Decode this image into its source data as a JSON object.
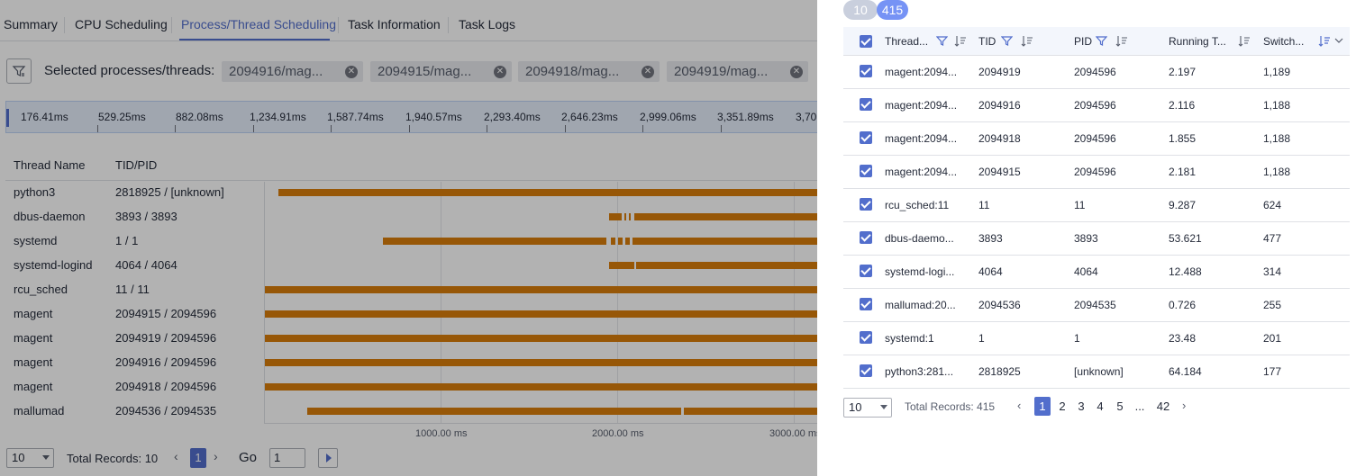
{
  "tabs": [
    "Summary",
    "CPU Scheduling",
    "Process/Thread Scheduling",
    "Task Information",
    "Task Logs"
  ],
  "active_tab": "Process/Thread Scheduling",
  "selection": {
    "label": "Selected processes/threads:",
    "chips": [
      "2094916/mag...",
      "2094915/mag...",
      "2094918/mag...",
      "2094919/mag..."
    ]
  },
  "timeline_ticks": [
    "176.41ms",
    "529.25ms",
    "882.08ms",
    "1,234.91ms",
    "1,587.74ms",
    "1,940.57ms",
    "2,293.40ms",
    "2,646.23ms",
    "2,999.06ms",
    "3,351.89ms",
    "3,70"
  ],
  "thread_table": {
    "headers": [
      "Thread Name",
      "TID/PID"
    ],
    "rows": [
      {
        "name": "python3",
        "tidpid": "2818925 / [unknown]"
      },
      {
        "name": "dbus-daemon",
        "tidpid": "3893 / 3893"
      },
      {
        "name": "systemd",
        "tidpid": "1 / 1"
      },
      {
        "name": "systemd-logind",
        "tidpid": "4064 / 4064"
      },
      {
        "name": "rcu_sched",
        "tidpid": "11 / 11"
      },
      {
        "name": "magent",
        "tidpid": "2094915 / 2094596"
      },
      {
        "name": "magent",
        "tidpid": "2094919 / 2094596"
      },
      {
        "name": "magent",
        "tidpid": "2094916 / 2094596"
      },
      {
        "name": "magent",
        "tidpid": "2094918 / 2094596"
      },
      {
        "name": "mallumad",
        "tidpid": "2094536 / 2094535"
      }
    ]
  },
  "gantt_axis": [
    "1000.00 ms",
    "2000.00 ms",
    "3000.00 ms"
  ],
  "left_pagination": {
    "page_size": "10",
    "total": "Total Records: 10",
    "current_page": "1",
    "go_label": "Go",
    "go_value": "1"
  },
  "panel": {
    "badges": [
      "10",
      "415"
    ],
    "columns": [
      "Thread...",
      "TID",
      "PID",
      "Running T...",
      "Switch..."
    ],
    "rows": [
      {
        "thread": "magent:2094...",
        "tid": "2094919",
        "pid": "2094596",
        "running": "2.197",
        "switch": "1,189"
      },
      {
        "thread": "magent:2094...",
        "tid": "2094916",
        "pid": "2094596",
        "running": "2.116",
        "switch": "1,188"
      },
      {
        "thread": "magent:2094...",
        "tid": "2094918",
        "pid": "2094596",
        "running": "1.855",
        "switch": "1,188"
      },
      {
        "thread": "magent:2094...",
        "tid": "2094915",
        "pid": "2094596",
        "running": "2.181",
        "switch": "1,188"
      },
      {
        "thread": "rcu_sched:11",
        "tid": "11",
        "pid": "11",
        "running": "9.287",
        "switch": "624"
      },
      {
        "thread": "dbus-daemo...",
        "tid": "3893",
        "pid": "3893",
        "running": "53.621",
        "switch": "477"
      },
      {
        "thread": "systemd-logi...",
        "tid": "4064",
        "pid": "4064",
        "running": "12.488",
        "switch": "314"
      },
      {
        "thread": "mallumad:20...",
        "tid": "2094536",
        "pid": "2094535",
        "running": "0.726",
        "switch": "255"
      },
      {
        "thread": "systemd:1",
        "tid": "1",
        "pid": "1",
        "running": "23.48",
        "switch": "201"
      },
      {
        "thread": "python3:281...",
        "tid": "2818925",
        "pid": "[unknown]",
        "running": "64.184",
        "switch": "177"
      }
    ],
    "pagination": {
      "page_size": "10",
      "total": "Total Records: 415",
      "pages": [
        "1",
        "2",
        "3",
        "4",
        "5",
        "...",
        "42"
      ],
      "current_page": "1"
    }
  },
  "colors": {
    "accent": "#526ecc",
    "bar": "#d97d0b",
    "badge_light": "#c9cfdd",
    "badge_dark": "#7693f5"
  }
}
